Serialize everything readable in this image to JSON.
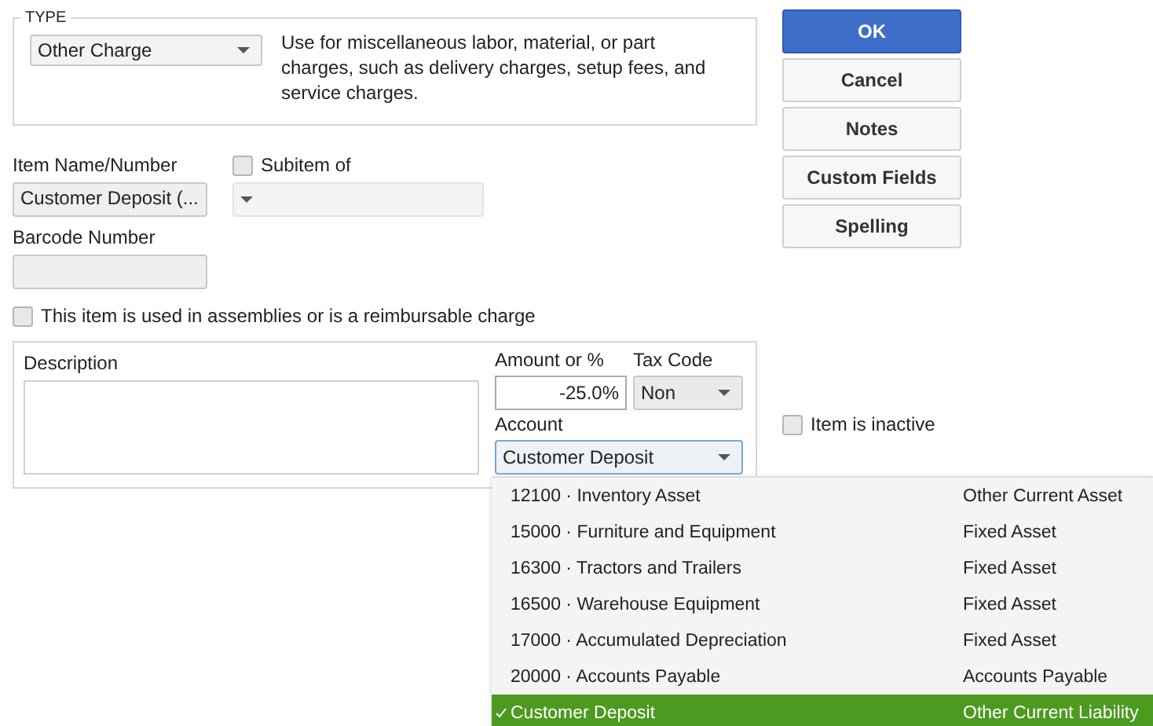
{
  "type_group": {
    "legend": "TYPE",
    "type_select": {
      "value": "Other Charge"
    },
    "help": "Use for miscellaneous labor, material, or part charges, such as delivery charges, setup fees, and service charges."
  },
  "item_name": {
    "label": "Item Name/Number",
    "value": "Customer Deposit (..."
  },
  "subitem": {
    "label": "Subitem of",
    "checked": false
  },
  "barcode": {
    "label": "Barcode Number"
  },
  "assemblies": {
    "label": "This item is used in assemblies or is a reimbursable charge",
    "checked": false
  },
  "description": {
    "label": "Description"
  },
  "amount": {
    "label": "Amount or %",
    "value": "-25.0%"
  },
  "tax_code": {
    "label": "Tax Code",
    "value": "Non"
  },
  "account": {
    "label": "Account",
    "value": "Customer Deposit"
  },
  "buttons": [
    {
      "label": "OK",
      "primary": true
    },
    {
      "label": "Cancel",
      "primary": false
    },
    {
      "label": "Notes",
      "primary": false
    },
    {
      "label": "Custom Fields",
      "primary": false
    },
    {
      "label": "Spelling",
      "primary": false
    }
  ],
  "inactive": {
    "label": "Item is inactive",
    "checked": false
  },
  "account_list": [
    {
      "name": "12100 · Inventory Asset",
      "type": "Other Current Asset",
      "selected": false
    },
    {
      "name": "15000 · Furniture and Equipment",
      "type": "Fixed Asset",
      "selected": false
    },
    {
      "name": "16300 · Tractors and Trailers",
      "type": "Fixed Asset",
      "selected": false
    },
    {
      "name": "16500 · Warehouse Equipment",
      "type": "Fixed Asset",
      "selected": false
    },
    {
      "name": "17000 · Accumulated Depreciation",
      "type": "Fixed Asset",
      "selected": false
    },
    {
      "name": "20000 · Accounts Payable",
      "type": "Accounts Payable",
      "selected": false
    },
    {
      "name": "Customer Deposit",
      "type": "Other Current Liability",
      "selected": true
    }
  ]
}
